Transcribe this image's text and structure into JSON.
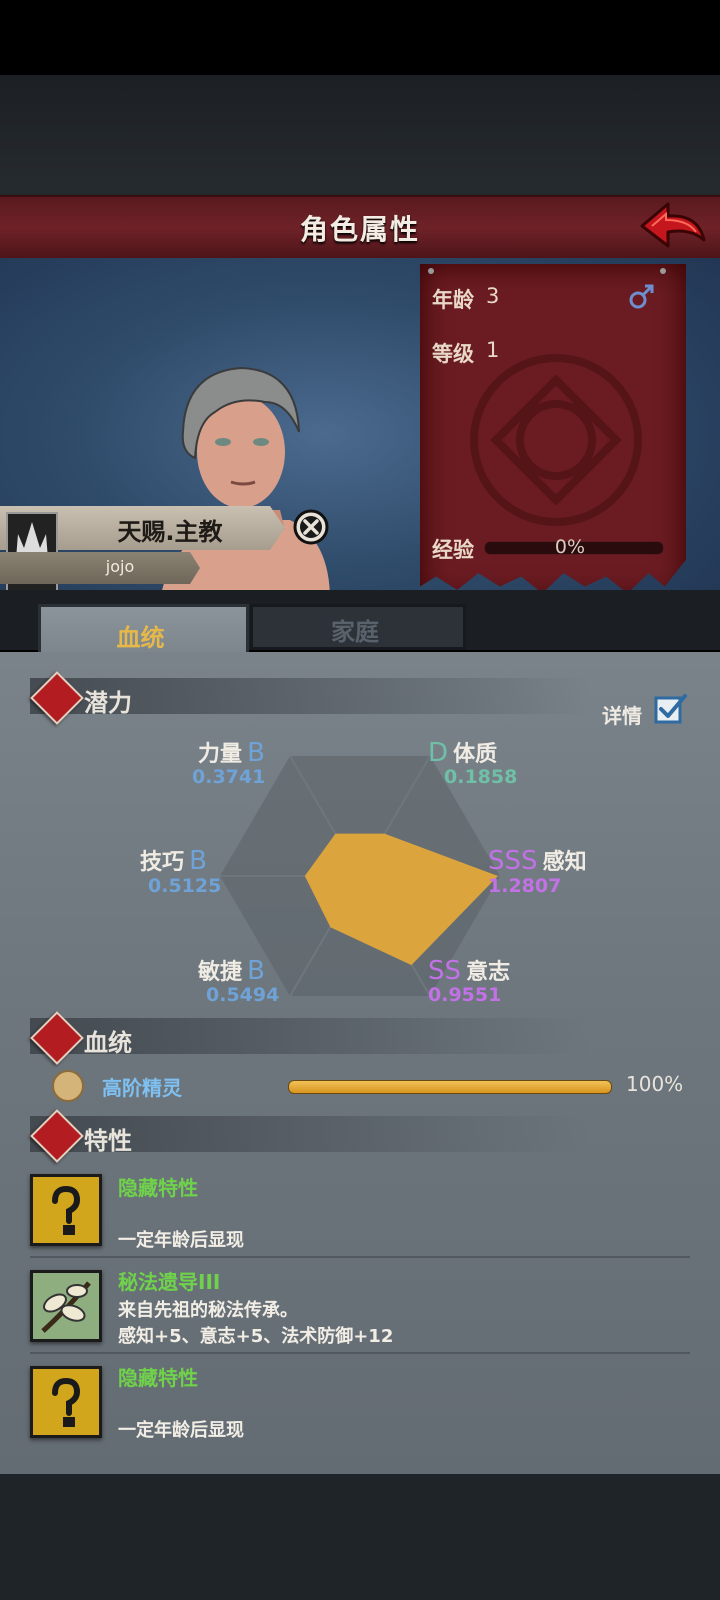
{
  "header": {
    "title": "角色属性",
    "back_icon": "back-arrow-icon"
  },
  "character": {
    "title": "天赐.主教",
    "name": "jojo",
    "gender_icon": "male-icon"
  },
  "stats": {
    "age_label": "年龄",
    "age_value": "3",
    "level_label": "等级",
    "level_value": "1",
    "exp_label": "经验",
    "exp_value": "0%",
    "exp_fraction": 0
  },
  "tabs": {
    "bloodline": "血统",
    "family": "家庭"
  },
  "potential": {
    "section_title": "潜力",
    "detail_label": "详情",
    "detail_checked": true,
    "attributes": [
      {
        "name": "力量",
        "grade": "B",
        "value": "0.3741"
      },
      {
        "name": "体质",
        "grade": "D",
        "value": "0.1858"
      },
      {
        "name": "感知",
        "grade": "SSS",
        "value": "1.2807"
      },
      {
        "name": "意志",
        "grade": "SS",
        "value": "0.9551"
      },
      {
        "name": "敏捷",
        "grade": "B",
        "value": "0.5494"
      },
      {
        "name": "技巧",
        "grade": "B",
        "value": "0.5125"
      }
    ],
    "radar_color": "#dba43c"
  },
  "bloodline": {
    "section_title": "血统",
    "entries": [
      {
        "name": "高阶精灵",
        "percent": "100%",
        "fraction": 1.0
      }
    ]
  },
  "traits": {
    "section_title": "特性",
    "items": [
      {
        "name": "隐藏特性",
        "desc1": "",
        "desc2": "一定年龄后显现",
        "icon": "question-mark-icon"
      },
      {
        "name": "秘法遗导III",
        "desc1": "来自先祖的秘法传承。",
        "desc2": "感知+5、意志+5、法术防御+12",
        "icon": "branch-icon"
      },
      {
        "name": "隐藏特性",
        "desc1": "",
        "desc2": "一定年龄后显现",
        "icon": "question-mark-icon"
      }
    ]
  }
}
